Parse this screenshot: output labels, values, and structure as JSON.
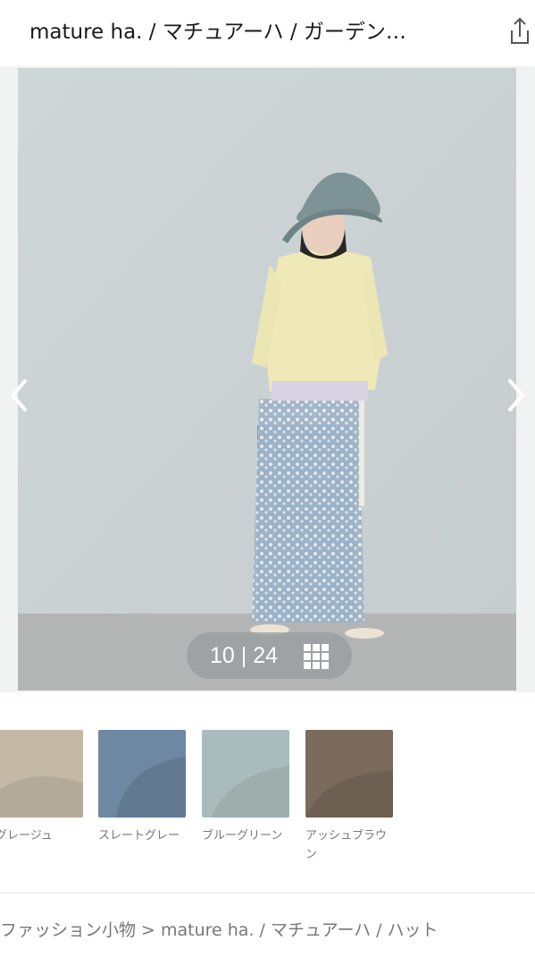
{
  "header": {
    "title": "mature ha. / マチュアーハ / ガーデン…"
  },
  "gallery": {
    "counter": "10 | 24"
  },
  "swatches": [
    {
      "label": "グレージュ",
      "color": "#c3b9a6"
    },
    {
      "label": "スレートグレー",
      "color": "#6e87a3"
    },
    {
      "label": "ブルーグリーン",
      "color": "#a9bcbb"
    },
    {
      "label": "アッシュブラウン",
      "color": "#7a6b5c"
    }
  ],
  "breadcrumb": "ファッション小物 > mature ha. / マチュアーハ / ハット"
}
